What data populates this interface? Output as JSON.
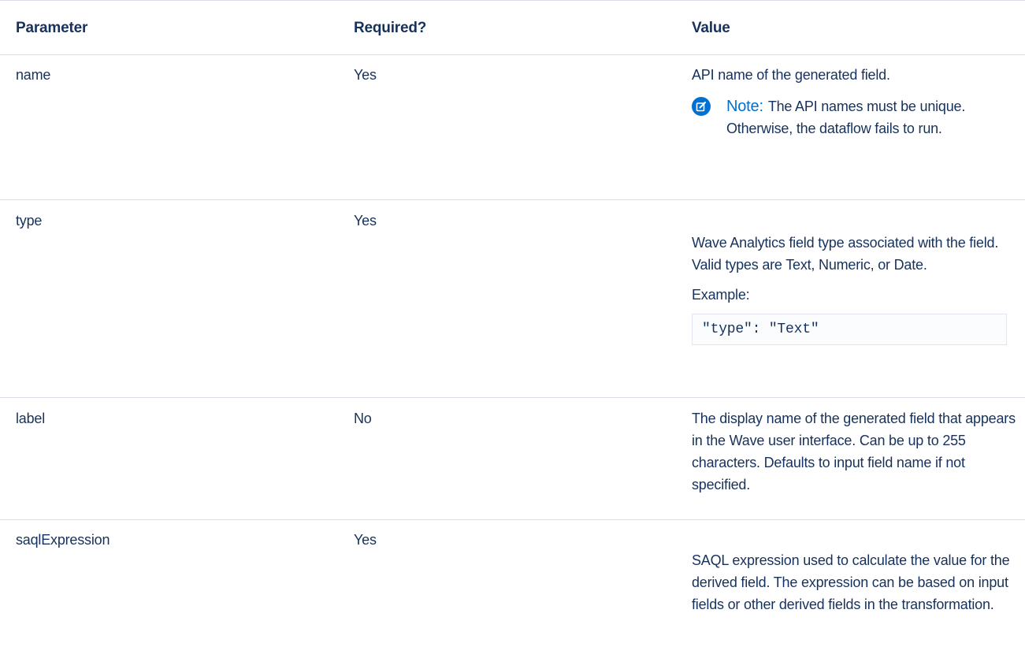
{
  "table": {
    "headers": {
      "parameter": "Parameter",
      "required": "Required?",
      "value": "Value"
    },
    "rows": [
      {
        "parameter": "name",
        "required": "Yes",
        "value": "API name of the generated field.",
        "note_label": "Note:",
        "note_text": "The API names must be unique. Otherwise, the dataflow fails to run."
      },
      {
        "parameter": "type",
        "required": "Yes",
        "value": "Wave Analytics field type associated with the field. Valid types are Text, Numeric, or Date.",
        "example_label": "Example:",
        "code": "\"type\": \"Text\""
      },
      {
        "parameter": "label",
        "required": "No",
        "value": "The display name of the generated field that appears in the Wave user interface. Can be up to 255 characters. Defaults to input field name if not specified."
      },
      {
        "parameter": "saqlExpression",
        "required": "Yes",
        "value": "SAQL expression used to calculate the value for the derived field. The expression can be based on input fields or other derived fields in the transformation."
      }
    ]
  },
  "icons": {
    "note": "edit-note-icon"
  },
  "colors": {
    "text": "#16325c",
    "accent": "#0070d2",
    "divider": "#d8dde6"
  }
}
